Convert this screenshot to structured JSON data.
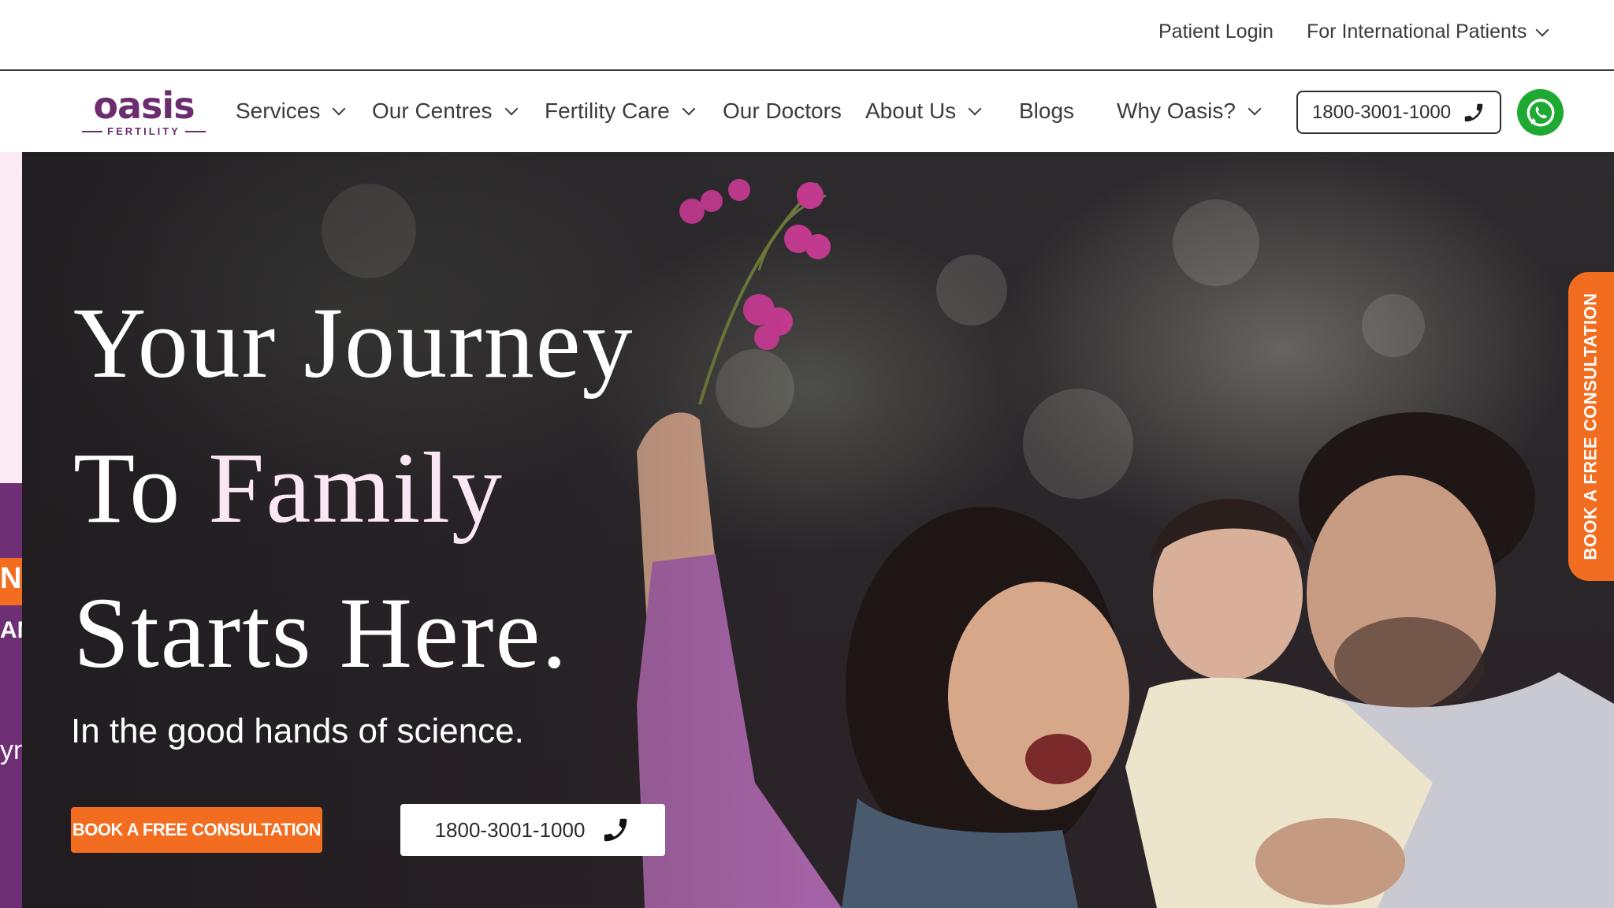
{
  "topbar": {
    "patient_login": "Patient Login",
    "international": "For International Patients"
  },
  "logo": {
    "word": "oasis",
    "sub": "FERTILITY"
  },
  "nav": {
    "items": [
      {
        "label": "Services",
        "dropdown": true
      },
      {
        "label": "Our Centres",
        "dropdown": true
      },
      {
        "label": "Fertility Care",
        "dropdown": true
      },
      {
        "label": "Our Doctors",
        "dropdown": false
      },
      {
        "label": "About Us",
        "dropdown": true
      },
      {
        "label": "Blogs",
        "dropdown": false
      },
      {
        "label": "Why Oasis?",
        "dropdown": true
      }
    ],
    "phone": "1800-3001-1000",
    "phone_icon": "phone-icon",
    "whatsapp_icon": "whatsapp-icon"
  },
  "hero": {
    "title_line1": "Your Journey",
    "title_line2_a": "To ",
    "title_line2_b": "Family",
    "title_line3": "Starts Here.",
    "subtitle": "In the good hands of science.",
    "book_button": "BOOK A FREE CONSULTATION",
    "phone_button": "1800-3001-1000",
    "side_tab": "BOOK A FREE CONSULTATION"
  },
  "left_strip": {
    "frag1": "NS",
    "frag2": "AN",
    "frag3": "yn"
  },
  "colors": {
    "brand_purple": "#6b2d6e",
    "accent_orange": "#f26d1f",
    "whatsapp_green": "#1fa832"
  }
}
